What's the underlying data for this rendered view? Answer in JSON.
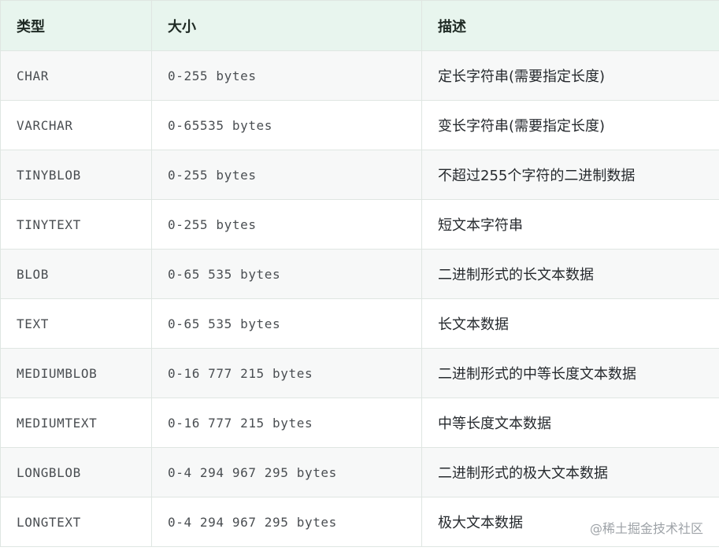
{
  "table": {
    "headers": [
      "类型",
      "大小",
      "描述"
    ],
    "rows": [
      {
        "type": "CHAR",
        "size": "0-255 bytes",
        "desc": "定长字符串(需要指定长度)"
      },
      {
        "type": "VARCHAR",
        "size": "0-65535 bytes",
        "desc": "变长字符串(需要指定长度)"
      },
      {
        "type": "TINYBLOB",
        "size": "0-255 bytes",
        "desc": "不超过255个字符的二进制数据"
      },
      {
        "type": "TINYTEXT",
        "size": "0-255 bytes",
        "desc": "短文本字符串"
      },
      {
        "type": "BLOB",
        "size": "0-65 535 bytes",
        "desc": "二进制形式的长文本数据"
      },
      {
        "type": "TEXT",
        "size": "0-65 535 bytes",
        "desc": "长文本数据"
      },
      {
        "type": "MEDIUMBLOB",
        "size": "0-16 777 215 bytes",
        "desc": "二进制形式的中等长度文本数据"
      },
      {
        "type": "MEDIUMTEXT",
        "size": "0-16 777 215 bytes",
        "desc": "中等长度文本数据"
      },
      {
        "type": "LONGBLOB",
        "size": "0-4 294 967 295 bytes",
        "desc": "二进制形式的极大文本数据"
      },
      {
        "type": "LONGTEXT",
        "size": "0-4 294 967 295 bytes",
        "desc": "极大文本数据"
      }
    ]
  },
  "watermark": "@稀土掘金技术社区"
}
